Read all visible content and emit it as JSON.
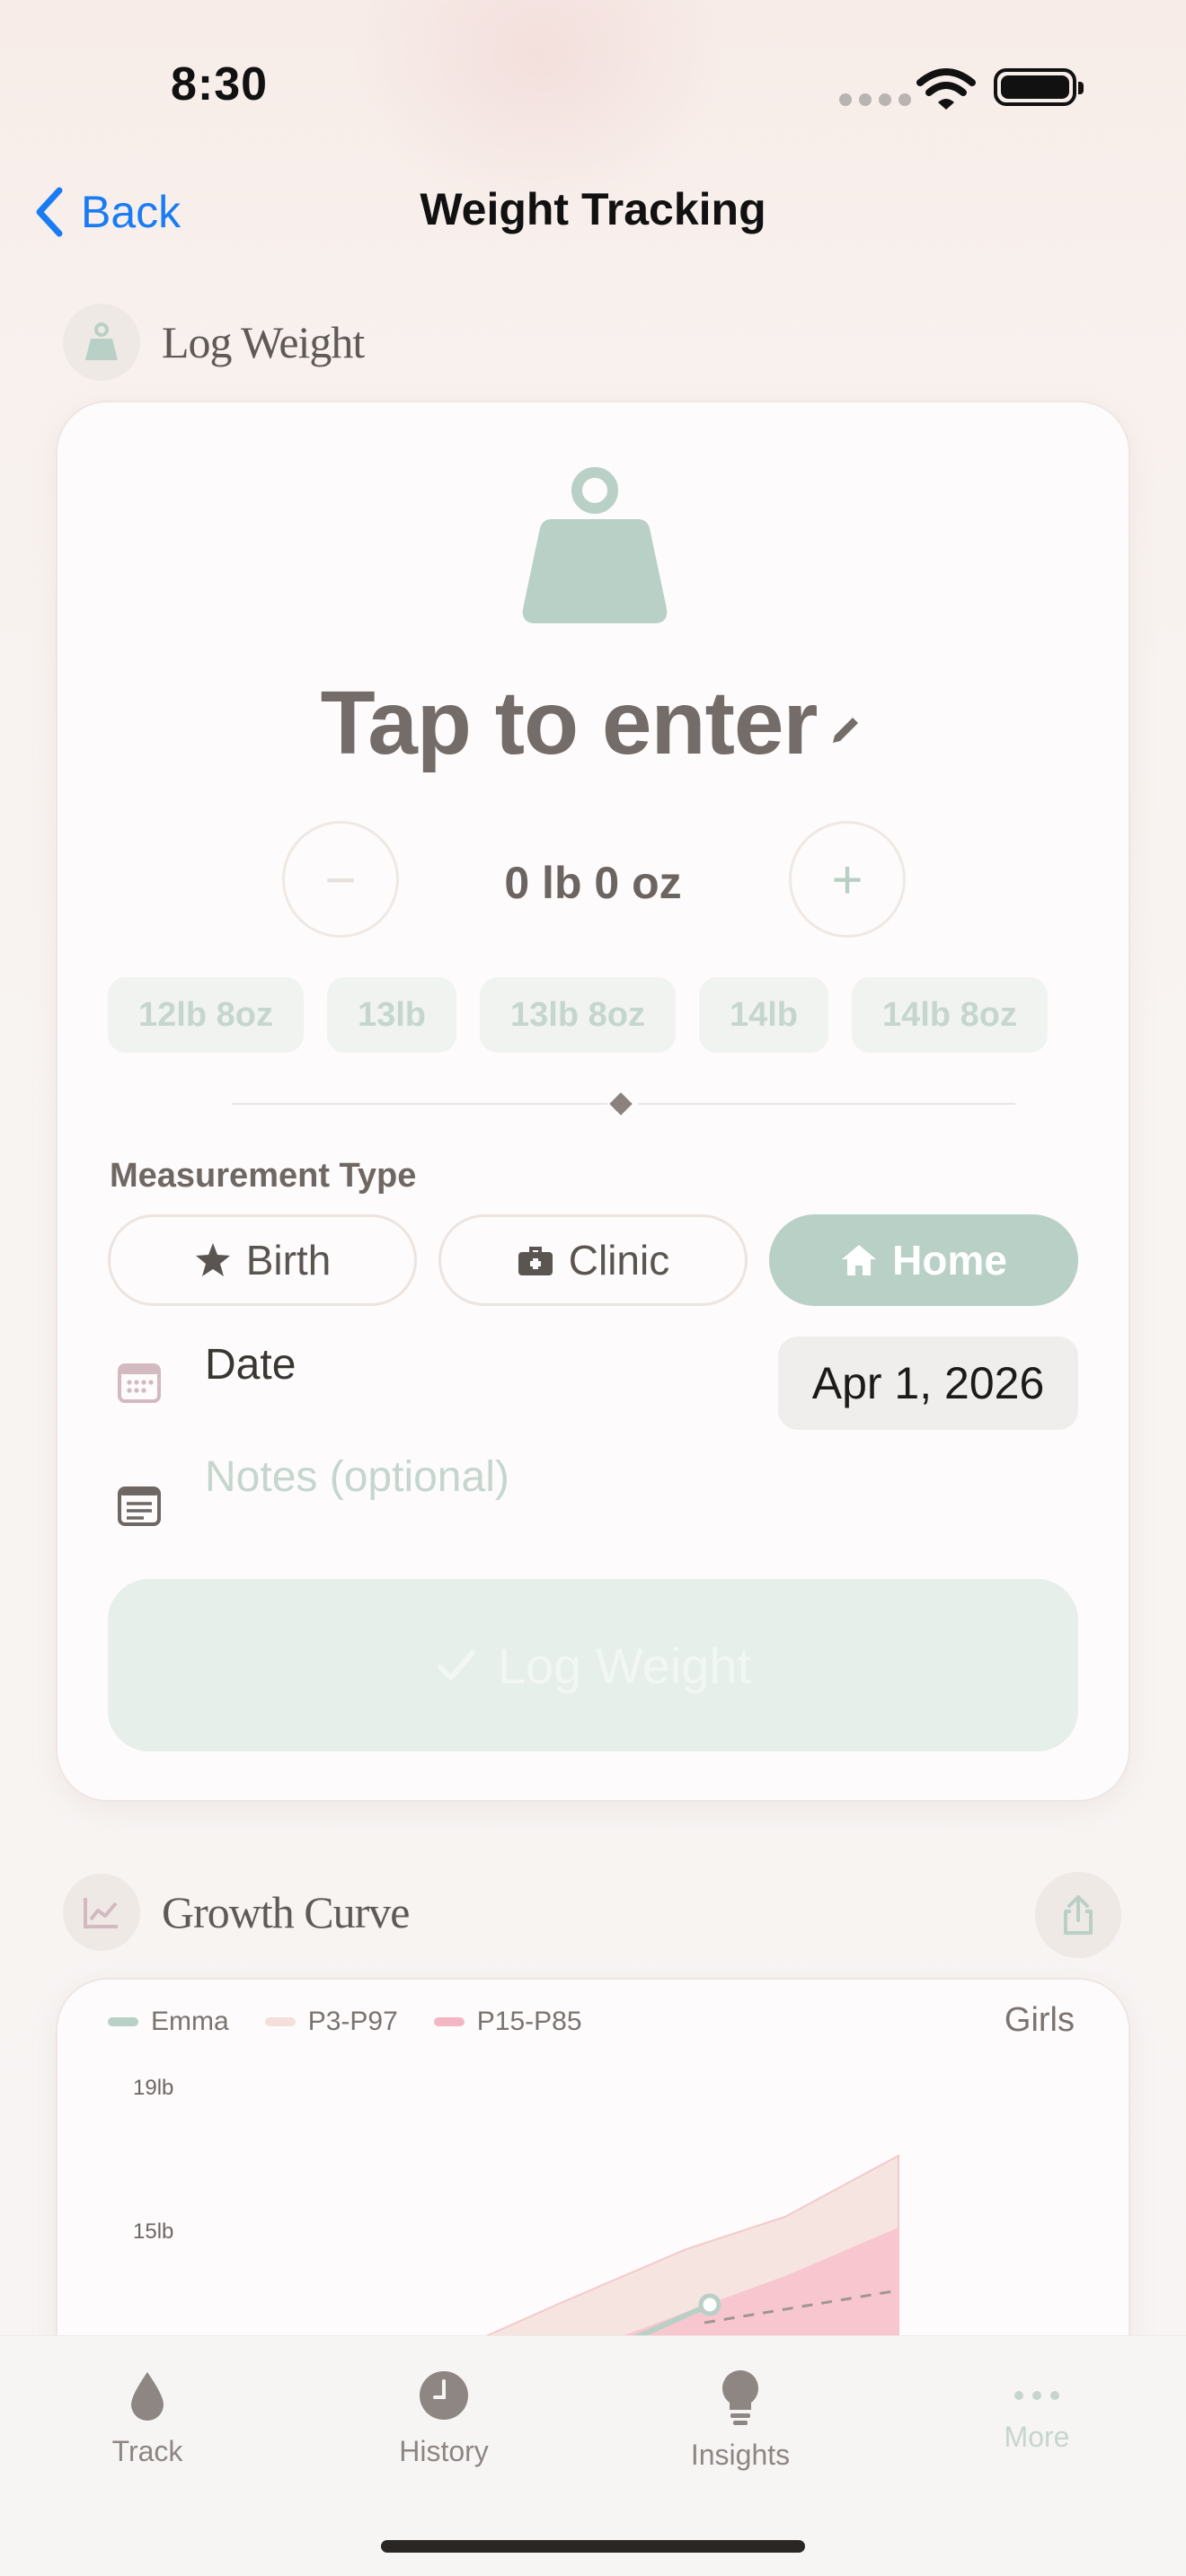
{
  "status_bar": {
    "time": "8:30"
  },
  "nav": {
    "back_label": "Back",
    "title": "Weight Tracking"
  },
  "log_section": {
    "title": "Log Weight",
    "prompt": "Tap to enter",
    "current_weight": "0 lb 0 oz",
    "minus": "−",
    "plus": "+",
    "presets": [
      "12lb 8oz",
      "13lb",
      "13lb 8oz",
      "14lb",
      "14lb 8oz"
    ],
    "measurement_type_label": "Measurement Type",
    "measurement_types": [
      {
        "label": "Birth",
        "icon": "star-icon",
        "selected": false
      },
      {
        "label": "Clinic",
        "icon": "medkit-icon",
        "selected": false
      },
      {
        "label": "Home",
        "icon": "house-icon",
        "selected": true
      }
    ],
    "date_label": "Date",
    "date_value": "Apr 1, 2026",
    "notes_placeholder": "Notes (optional)",
    "submit_label": "Log Weight"
  },
  "growth_section": {
    "title": "Growth Curve",
    "gender": "Girls",
    "legend": [
      {
        "label": "Emma",
        "color": "#b8d0c6"
      },
      {
        "label": "P3-P97",
        "color": "#f6dedd"
      },
      {
        "label": "P15-P85",
        "color": "#f3b7c4"
      }
    ]
  },
  "chart_data": {
    "type": "area",
    "y_tick_labels": [
      "19lb",
      "15lb"
    ],
    "series": [
      {
        "name": "Emma",
        "points_visible": 1
      },
      {
        "name": "P3-P97"
      },
      {
        "name": "P15-P85"
      }
    ]
  },
  "tab_bar": {
    "tabs": [
      {
        "label": "Track",
        "icon": "drop-icon"
      },
      {
        "label": "History",
        "icon": "clock-icon"
      },
      {
        "label": "Insights",
        "icon": "lightbulb-icon"
      },
      {
        "label": "More",
        "icon": "ellipsis-icon"
      }
    ]
  },
  "colors": {
    "accent": "#b8d0c6",
    "link": "#1a7cf2",
    "text": "#5f5a57"
  }
}
